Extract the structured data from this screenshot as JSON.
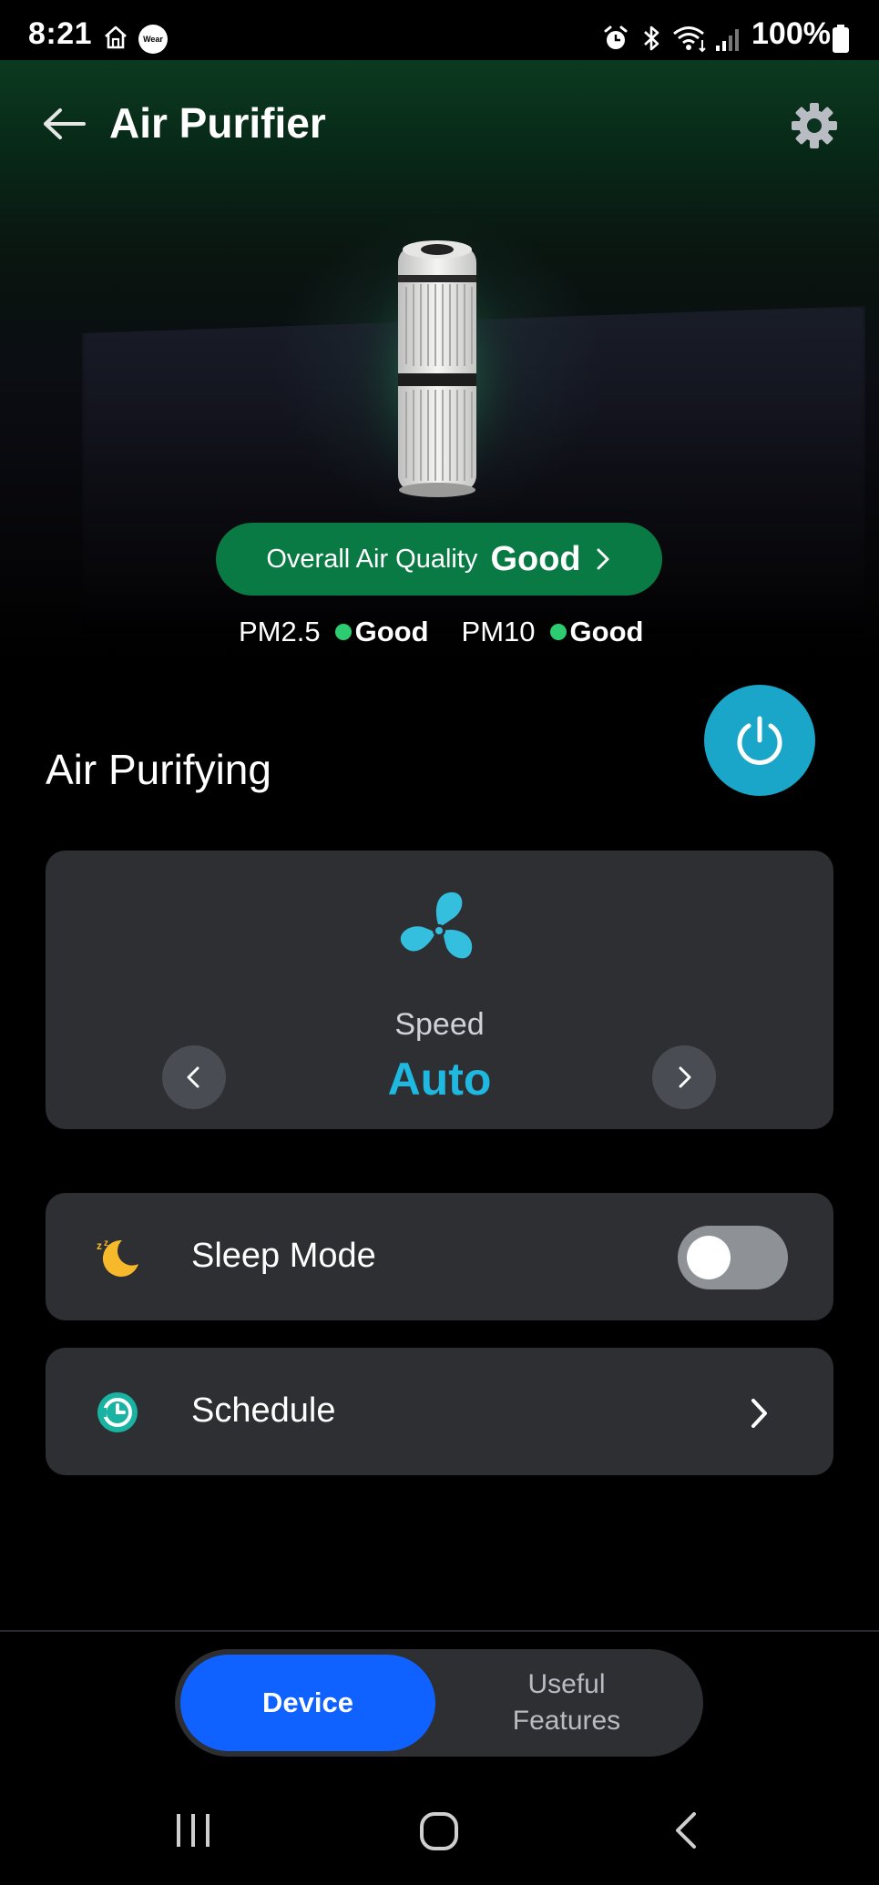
{
  "status_bar": {
    "time": "8:21",
    "battery": "100%",
    "left_icons": [
      "home-icon",
      "wear-icon"
    ],
    "wear_label": "Wear",
    "right_icons": [
      "alarm-icon",
      "bluetooth-icon",
      "wifi-icon",
      "signal-icon",
      "battery-icon"
    ]
  },
  "header": {
    "title": "Air Purifier",
    "back_icon": "back-arrow-icon",
    "settings_icon": "gear-icon"
  },
  "air_quality": {
    "label": "Overall Air Quality",
    "value": "Good",
    "pm25_label": "PM2.5",
    "pm25_value": "Good",
    "pm10_label": "PM10",
    "pm10_value": "Good",
    "good_color": "#2ecc71"
  },
  "section": {
    "title": "Air Purifying"
  },
  "speed": {
    "label": "Speed",
    "value": "Auto",
    "accent": "#1fb8e0"
  },
  "sleep_mode": {
    "label": "Sleep Mode",
    "enabled": false
  },
  "schedule": {
    "label": "Schedule"
  },
  "bottom_tabs": {
    "device": "Device",
    "useful_line1": "Useful",
    "useful_line2": "Features",
    "active": "Device"
  },
  "colors": {
    "brand_green": "#0a7a45",
    "power_blue": "#1aa6c8",
    "active_tab": "#0f62ff",
    "card_bg": "#2d2f33"
  }
}
